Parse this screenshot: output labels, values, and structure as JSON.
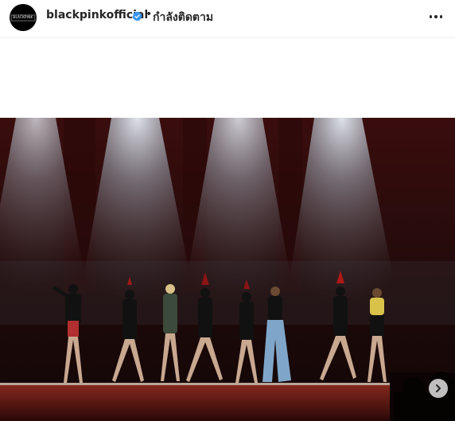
{
  "post": {
    "username": "blackpinkofficial",
    "verified": true,
    "separator": "•",
    "follow_label": "กำลังติดตาม",
    "avatar_text": "BLACKPINK",
    "more_icon": "more-horizontal-icon",
    "next_icon": "chevron-right-icon"
  },
  "colors": {
    "verified_blue": "#3897f0",
    "stage_red": "#5a1212",
    "text": "#262626"
  }
}
